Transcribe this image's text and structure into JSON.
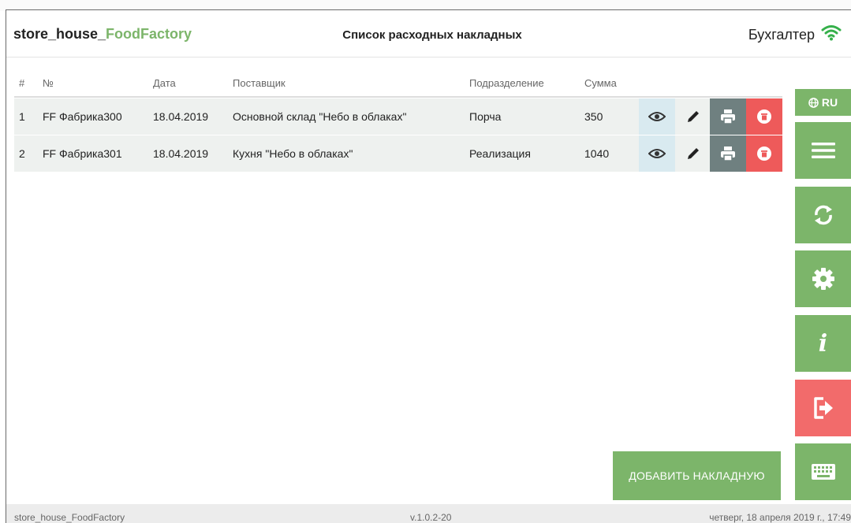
{
  "header": {
    "brand_prefix": "store_house_",
    "brand_accent": "FoodFactory",
    "title": "Список расходных накладных",
    "role": "Бухгалтер",
    "wifi_icon": "wifi-icon"
  },
  "table": {
    "columns": {
      "idx": "#",
      "num": "№",
      "date": "Дата",
      "supplier": "Поставщик",
      "division": "Подразделение",
      "sum": "Сумма"
    },
    "rows": [
      {
        "idx": "1",
        "num": "FF Фабрика300",
        "date": "18.04.2019",
        "supplier": "Основной склад \"Небо в облаках\"",
        "division": "Порча",
        "sum": "350"
      },
      {
        "idx": "2",
        "num": "FF Фабрика301",
        "date": "18.04.2019",
        "supplier": "Кухня \"Небо в облаках\"",
        "division": "Реализация",
        "sum": "1040"
      }
    ]
  },
  "sidebar": {
    "lang_label": "RU",
    "lang_icon": "globe-icon",
    "info_label": "i"
  },
  "actions": {
    "add_label": "ДОБАВИТЬ НАКЛАДНУЮ"
  },
  "footer": {
    "left": "store_house_FoodFactory",
    "version": "v.1.0.2-20",
    "datetime": "четверг, 18 апреля 2019 г., 17:49"
  },
  "colors": {
    "accent_green": "#7cb56a",
    "danger_red": "#ee5a5a",
    "print_gray": "#6f8080",
    "view_blue": "#d9eaf0"
  }
}
